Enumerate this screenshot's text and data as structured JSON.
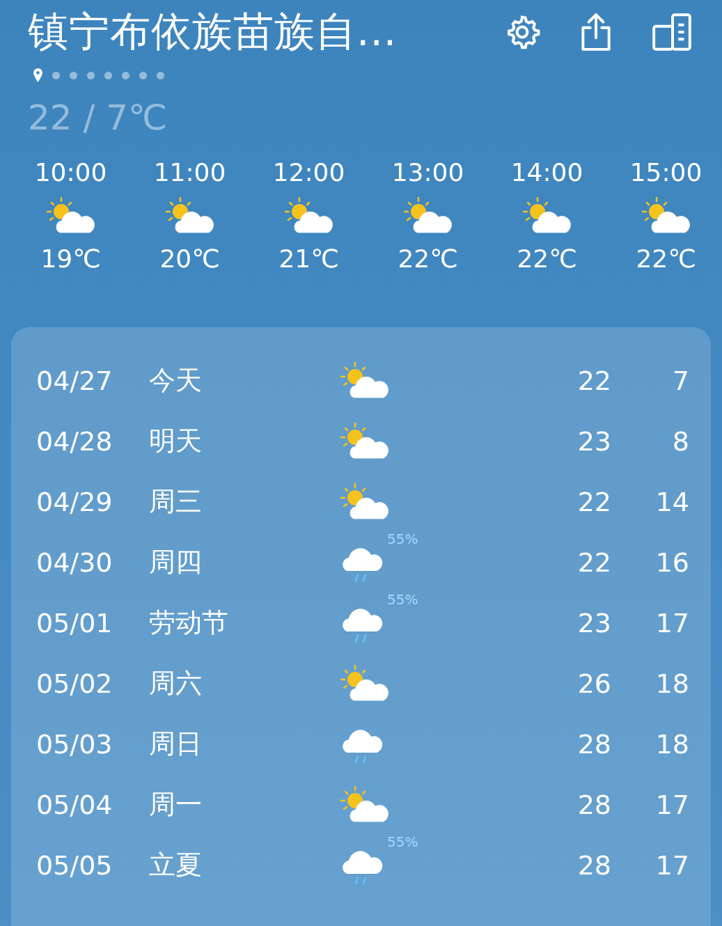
{
  "header": {
    "title": "镇宁布依族苗族自...",
    "temperature_range": "22 / 7℃"
  },
  "pages": [
    {
      "kind": "location",
      "selected": true
    },
    {
      "kind": "dot",
      "selected": false
    },
    {
      "kind": "dot",
      "selected": false
    },
    {
      "kind": "dot",
      "selected": false
    },
    {
      "kind": "dot",
      "selected": false
    },
    {
      "kind": "dot",
      "selected": false
    },
    {
      "kind": "dot",
      "selected": false
    },
    {
      "kind": "dot",
      "selected": false
    }
  ],
  "hourly": [
    {
      "time": "10:00",
      "kind": "partly_cloudy",
      "temp": "19℃"
    },
    {
      "time": "11:00",
      "kind": "partly_cloudy",
      "temp": "20℃"
    },
    {
      "time": "12:00",
      "kind": "partly_cloudy",
      "temp": "21℃"
    },
    {
      "time": "13:00",
      "kind": "partly_cloudy",
      "temp": "22℃"
    },
    {
      "time": "14:00",
      "kind": "partly_cloudy",
      "temp": "22℃"
    },
    {
      "time": "15:00",
      "kind": "partly_cloudy",
      "temp": "22℃"
    }
  ],
  "daily": [
    {
      "date": "04/27",
      "day": "今天",
      "kind": "partly_cloudy",
      "high": "22",
      "low": "7"
    },
    {
      "date": "04/28",
      "day": "明天",
      "kind": "partly_cloudy",
      "high": "23",
      "low": "8"
    },
    {
      "date": "04/29",
      "day": "周三",
      "kind": "partly_cloudy",
      "high": "22",
      "low": "14"
    },
    {
      "date": "04/30",
      "day": "周四",
      "kind": "rain",
      "precip": "55%",
      "high": "22",
      "low": "16"
    },
    {
      "date": "05/01",
      "day": "劳动节",
      "kind": "rain",
      "precip": "55%",
      "high": "23",
      "low": "17"
    },
    {
      "date": "05/02",
      "day": "周六",
      "kind": "partly_cloudy",
      "high": "26",
      "low": "18"
    },
    {
      "date": "05/03",
      "day": "周日",
      "kind": "rain",
      "high": "28",
      "low": "18"
    },
    {
      "date": "05/04",
      "day": "周一",
      "kind": "partly_cloudy",
      "high": "28",
      "low": "17"
    },
    {
      "date": "05/05",
      "day": "立夏",
      "kind": "rain",
      "precip": "55%",
      "high": "28",
      "low": "17"
    }
  ]
}
